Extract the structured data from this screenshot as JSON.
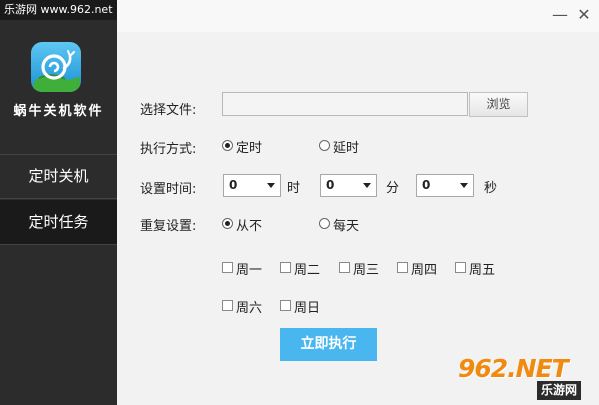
{
  "watermark": {
    "top": "乐游网 www.962.net",
    "brand": "962.NET",
    "site": "乐游网"
  },
  "app": {
    "name": "蜗牛关机软件",
    "logo_icon": "snail-icon"
  },
  "sidebar": {
    "items": [
      {
        "label": "定时关机",
        "selected": false
      },
      {
        "label": "定时任务",
        "selected": true
      }
    ]
  },
  "window": {
    "minimize": "—",
    "close": "✕"
  },
  "form": {
    "file_label": "选择文件:",
    "file_value": "",
    "browse_label": "浏览",
    "mode_label": "执行方式:",
    "mode_options": [
      {
        "label": "定时",
        "checked": true
      },
      {
        "label": "延时",
        "checked": false
      }
    ],
    "time_label": "设置时间:",
    "hour": "0",
    "hour_unit": "时",
    "minute": "0",
    "minute_unit": "分",
    "second": "0",
    "second_unit": "秒",
    "repeat_label": "重复设置:",
    "repeat_options": [
      {
        "label": "从不",
        "checked": true
      },
      {
        "label": "每天",
        "checked": false
      }
    ],
    "weekdays": [
      {
        "label": "周一",
        "checked": false
      },
      {
        "label": "周二",
        "checked": false
      },
      {
        "label": "周三",
        "checked": false
      },
      {
        "label": "周四",
        "checked": false
      },
      {
        "label": "周五",
        "checked": false
      },
      {
        "label": "周六",
        "checked": false
      },
      {
        "label": "周日",
        "checked": false
      }
    ],
    "execute_label": "立即执行"
  },
  "colors": {
    "sidebar": "#2c2c2c",
    "selected": "#1a1a1a",
    "accent": "#49b6f0",
    "watermark": "#f08a10"
  }
}
